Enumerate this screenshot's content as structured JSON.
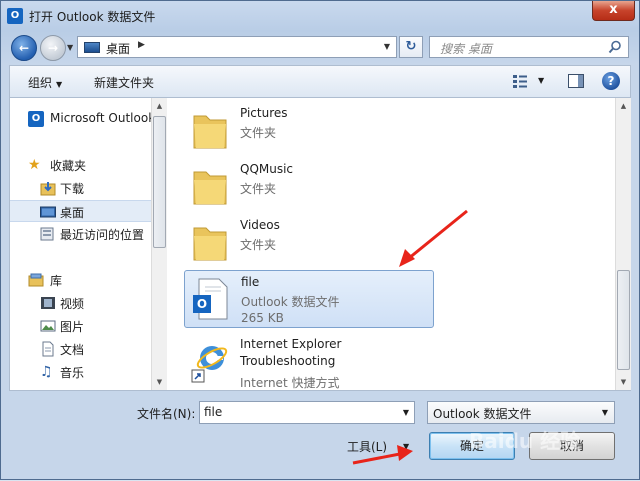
{
  "window": {
    "title": "打开 Outlook 数据文件",
    "app_icon": "outlook-icon",
    "close_symbol": "x"
  },
  "nav": {
    "back_icon": "back-arrow-icon",
    "forward_icon": "forward-arrow-icon",
    "address_location": "桌面",
    "refresh_icon": "refresh-icon",
    "search_placeholder": "搜索 桌面"
  },
  "toolbar": {
    "organize_label": "组织",
    "new_folder_label": "新建文件夹",
    "help_symbol": "?"
  },
  "sidebar": {
    "items": [
      {
        "label": "Microsoft Outlook",
        "icon": "outlook-icon"
      },
      {
        "label": "收藏夹",
        "icon": "star-icon"
      },
      {
        "label": "下载",
        "icon": "download-folder-icon"
      },
      {
        "label": "桌面",
        "icon": "desktop-icon",
        "selected": true
      },
      {
        "label": "最近访问的位置",
        "icon": "recent-places-icon"
      },
      {
        "label": "库",
        "icon": "library-icon"
      },
      {
        "label": "视频",
        "icon": "video-icon"
      },
      {
        "label": "图片",
        "icon": "picture-icon"
      },
      {
        "label": "文档",
        "icon": "document-icon"
      },
      {
        "label": "音乐",
        "icon": "music-icon"
      }
    ]
  },
  "files": [
    {
      "name": "Pictures",
      "type": "文件夹",
      "icon": "folder-icon"
    },
    {
      "name": "QQMusic",
      "type": "文件夹",
      "icon": "folder-icon"
    },
    {
      "name": "Videos",
      "type": "文件夹",
      "icon": "folder-icon"
    },
    {
      "name": "file",
      "type": "Outlook 数据文件",
      "size": "265 KB",
      "icon": "outlook-data-file-icon",
      "selected": true
    },
    {
      "name": "Internet Explorer Troubleshooting",
      "type": "Internet 快捷方式",
      "icon": "internet-explorer-shortcut-icon"
    }
  ],
  "footer": {
    "filename_label": "文件名(N):",
    "filename_value": "file",
    "filetype_value": "Outlook 数据文件",
    "tools_label": "工具(L)",
    "ok_label": "确定",
    "cancel_label": "取消"
  },
  "watermark": "Baidu 经验",
  "colors": {
    "selection_bg": "#cfe0f6",
    "annotation_arrow": "#e8241a",
    "close_button": "#c7432b"
  }
}
